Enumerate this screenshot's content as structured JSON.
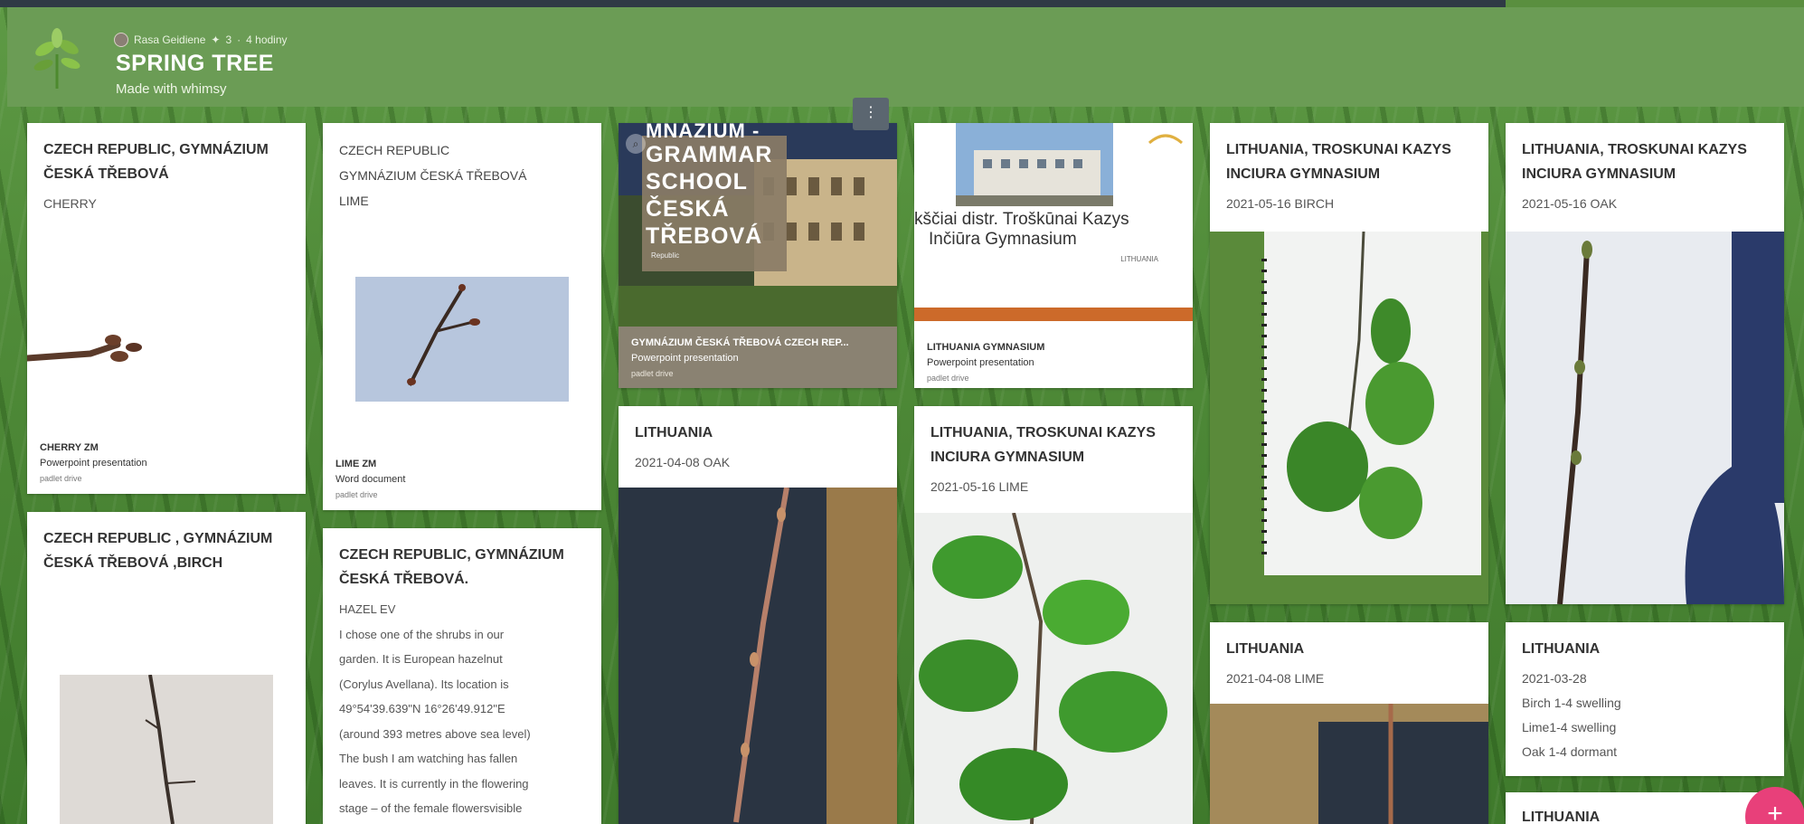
{
  "header": {
    "author": "Rasa Geidiene",
    "likes": "3",
    "time": "4 hodiny",
    "title": "SPRING TREE",
    "subtitle": "Made with whimsy"
  },
  "cards": {
    "c1": {
      "title": "CZECH REPUBLIC, GYMNÁZIUM ČESKÁ TŘEBOVÁ",
      "body": "CHERRY",
      "att_name": "CHERRY ZM",
      "att_type": "Powerpoint presentation",
      "att_src": "padlet drive"
    },
    "c2": {
      "title": "CZECH REPUBLIC , GYMNÁZIUM ČESKÁ TŘEBOVÁ ,BIRCH"
    },
    "c3": {
      "line1": "CZECH REPUBLIC",
      "line2": "GYMNÁZIUM ČESKÁ TŘEBOVÁ",
      "line3": "LIME",
      "att_name": "LIME ZM",
      "att_type": "Word document",
      "att_src": "padlet drive"
    },
    "c4": {
      "title": "CZECH REPUBLIC, GYMNÁZIUM ČESKÁ TŘEBOVÁ.",
      "body_lines": [
        "HAZEL EV",
        "I chose one of the shrubs in our",
        "garden. It is European hazelnut",
        "(Corylus Avellana). Its location is",
        "49°54'39.639\"N 16°26'49.912\"E",
        "(around 393 metres above sea level)",
        "The bush I am watching has fallen",
        "leaves. It is currently in the flowering",
        "stage – of the female flowersvisible"
      ]
    },
    "c5": {
      "slide_top": "MNÁZIUM -",
      "slide_lines": [
        "GRAMMAR",
        "SCHOOL",
        "ČESKÁ",
        "TŘEBOVÁ"
      ],
      "slide_small": "Republic",
      "att_name": "GYMNÁZIUM ČESKÁ TŘEBOVÁ CZECH REP...",
      "att_type": "Powerpoint presentation",
      "att_src": "padlet drive"
    },
    "c6": {
      "title": "LITHUANIA",
      "body": "2021-04-08 OAK"
    },
    "c7": {
      "slide_line1": "kščiai distr. Troškūnai Kazys",
      "slide_line2": "Inčiūra Gymnasium",
      "slide_small": "LITHUANIA",
      "att_name": "LITHUANIA GYMNASIUM",
      "att_type": "Powerpoint presentation",
      "att_src": "padlet drive"
    },
    "c8": {
      "title": "LITHUANIA, TROSKUNAI KAZYS INCIURA GYMNASIUM",
      "body": "2021-05-16 LIME"
    },
    "c9": {
      "title": "LITHUANIA, TROSKUNAI KAZYS INCIURA GYMNASIUM",
      "body": "2021-05-16 BIRCH"
    },
    "c10": {
      "title": "LITHUANIA",
      "body": "2021-04-08 LIME"
    },
    "c11": {
      "title": "LITHUANIA, TROSKUNAI KAZYS INCIURA GYMNASIUM",
      "body": "2021-05-16 OAK"
    },
    "c12": {
      "title": "LITHUANIA",
      "body_lines": [
        "2021-03-28",
        "Birch 1-4 swelling",
        "Lime1-4 swelling",
        "Oak 1-4 dormant"
      ]
    },
    "c13": {
      "title": "LITHUANIA"
    }
  },
  "menu_glyph": "⋮",
  "fab_glyph": "+",
  "colors": {
    "header": "#6b9c55",
    "fab": "#e8407a",
    "card": "#ffffff"
  }
}
